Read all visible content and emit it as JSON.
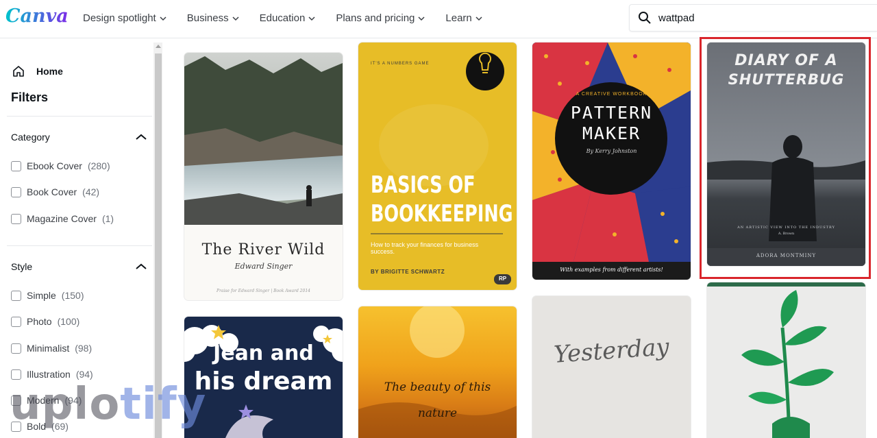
{
  "app": {
    "logo": "Canva"
  },
  "nav": [
    {
      "label": "Design spotlight"
    },
    {
      "label": "Business"
    },
    {
      "label": "Education"
    },
    {
      "label": "Plans and pricing"
    },
    {
      "label": "Learn"
    }
  ],
  "search": {
    "value": "wattpad"
  },
  "sidebar": {
    "home_label": "Home",
    "filters_title": "Filters",
    "category": {
      "title": "Category",
      "items": [
        {
          "label": "Ebook Cover",
          "count": "(280)"
        },
        {
          "label": "Book Cover",
          "count": "(42)"
        },
        {
          "label": "Magazine Cover",
          "count": "(1)"
        }
      ]
    },
    "style": {
      "title": "Style",
      "items": [
        {
          "label": "Simple",
          "count": "(150)"
        },
        {
          "label": "Photo",
          "count": "(100)"
        },
        {
          "label": "Minimalist",
          "count": "(98)"
        },
        {
          "label": "Illustration",
          "count": "(94)"
        },
        {
          "label": "Modern",
          "count": "(94)"
        },
        {
          "label": "Bold",
          "count": "(69)"
        }
      ]
    }
  },
  "watermark": {
    "text_a": "uplo",
    "text_b": "tify"
  },
  "templates": {
    "river": {
      "title": "The River Wild",
      "author": "Edward Singer",
      "footer": "Praise for Edward Singer | Book Award 2014"
    },
    "bookkeeping": {
      "tagline": "IT'S A NUMBERS GAME",
      "title_1": "BASICS OF",
      "title_2": "BOOKKEEPING",
      "subtitle": "How to track your finances for business success.",
      "author": "BY BRIGITTE SCHWARTZ",
      "badge": "RP"
    },
    "pattern": {
      "kicker": "A CREATIVE WORKBOOK",
      "title_1": "PATTERN",
      "title_2": "MAKER",
      "author": "By Kerry Johnston",
      "footer": "With examples from different artists!"
    },
    "shutterbug": {
      "title_1": "DIARY OF A",
      "title_2": "SHUTTERBUG",
      "tagline": "AN ARTISTIC VIEW INTO THE INDUSTRY",
      "author_small": "A. Brown",
      "author": "ADORA MONTMINY"
    },
    "jean": {
      "title_1": "Jean and",
      "title_2": "his dream"
    },
    "beauty": {
      "title_1": "The beauty of this",
      "title_2": "nature"
    },
    "yesterday": {
      "title": "Yesterday"
    }
  },
  "colors": {
    "highlight": "#d9252b",
    "canva_teal": "#00c4cc",
    "canva_purple": "#7d2ae8"
  }
}
